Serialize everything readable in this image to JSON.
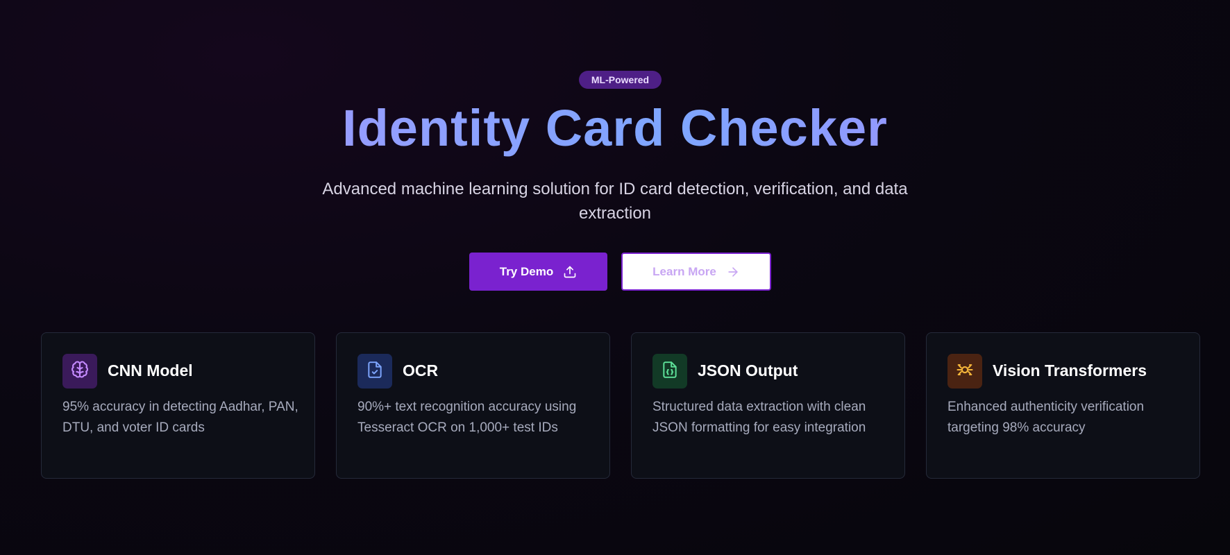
{
  "hero": {
    "badge": "ML-Powered",
    "title": "Identity Card Checker",
    "subtitle": "Advanced machine learning solution for ID card detection, verification, and data extraction",
    "primary_button": "Try Demo",
    "secondary_button": "Learn More"
  },
  "features": [
    {
      "title": "CNN Model",
      "description": "95% accuracy in detecting Aadhar, PAN, DTU, and voter ID cards",
      "icon": "brain-icon",
      "accent": "#c58bff",
      "icon_bg": "#3a1a5a"
    },
    {
      "title": "OCR",
      "description": "90%+ text recognition accuracy using Tesseract OCR on 1,000+ test IDs",
      "icon": "file-check-icon",
      "accent": "#7ea6ff",
      "icon_bg": "#1b2a5a"
    },
    {
      "title": "JSON Output",
      "description": "Structured data extraction with clean JSON formatting for easy integration",
      "icon": "file-json-icon",
      "accent": "#5ee39a",
      "icon_bg": "#123a26"
    },
    {
      "title": "Vision Transformers",
      "description": "Enhanced authenticity verification targeting 98% accuracy",
      "icon": "scan-eye-icon",
      "accent": "#f3b43a",
      "icon_bg": "#4a2312"
    }
  ]
}
